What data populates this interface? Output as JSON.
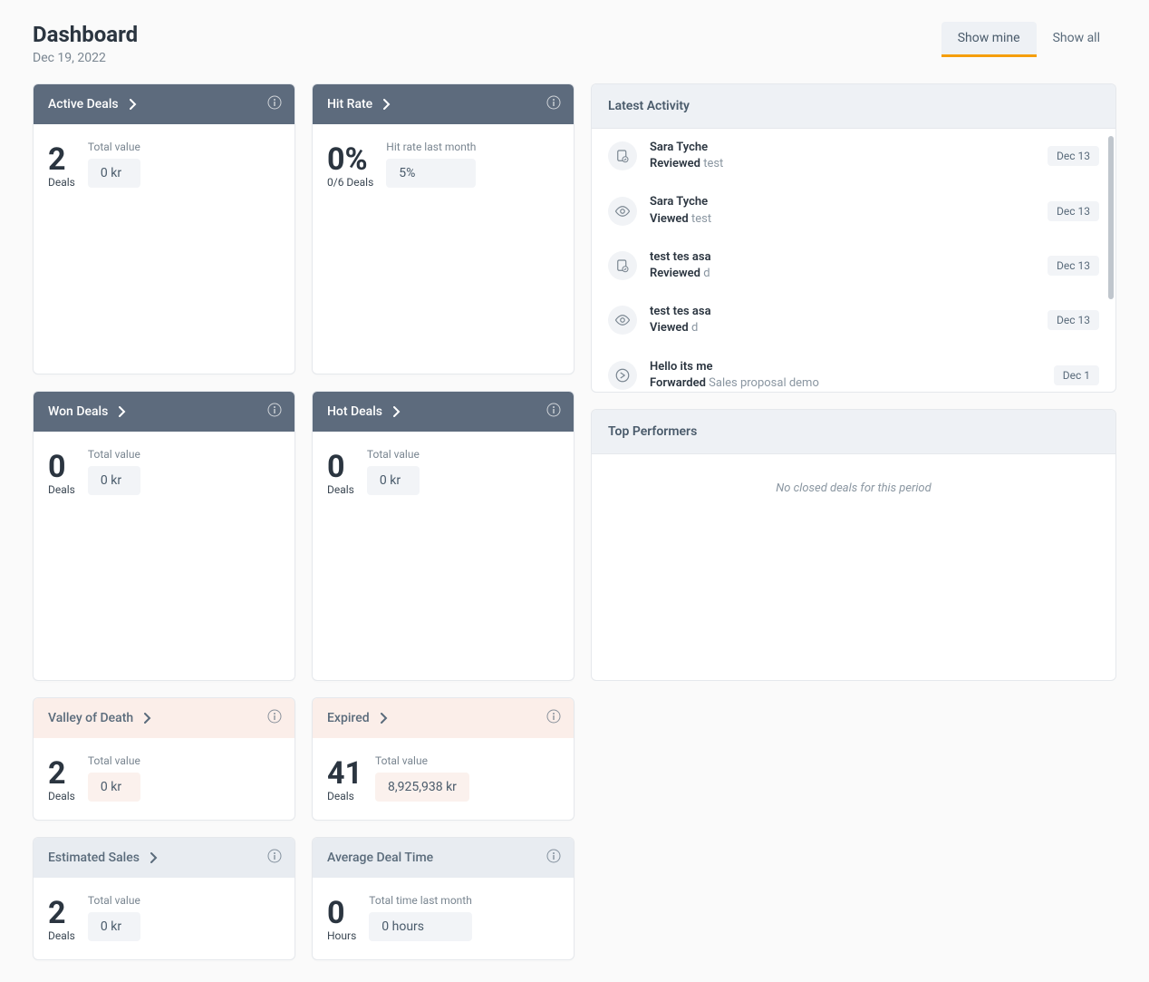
{
  "header": {
    "title": "Dashboard",
    "date": "Dec 19, 2022"
  },
  "tabs": {
    "show_mine": "Show mine",
    "show_all": "Show all"
  },
  "cards": {
    "active_deals": {
      "title": "Active Deals",
      "count": "2",
      "unit": "Deals",
      "sub_label": "Total value",
      "sub_value": "0 kr"
    },
    "hit_rate": {
      "title": "Hit Rate",
      "count": "0%",
      "unit": "0/6 Deals",
      "sub_label": "Hit rate last month",
      "sub_value": "5%"
    },
    "won_deals": {
      "title": "Won Deals",
      "count": "0",
      "unit": "Deals",
      "sub_label": "Total value",
      "sub_value": "0 kr"
    },
    "hot_deals": {
      "title": "Hot Deals",
      "count": "0",
      "unit": "Deals",
      "sub_label": "Total value",
      "sub_value": "0 kr"
    },
    "valley_of_death": {
      "title": "Valley of Death",
      "count": "2",
      "unit": "Deals",
      "sub_label": "Total value",
      "sub_value": "0 kr"
    },
    "expired": {
      "title": "Expired",
      "count": "41",
      "unit": "Deals",
      "sub_label": "Total value",
      "sub_value": "8,925,938 kr"
    },
    "estimated_sales": {
      "title": "Estimated Sales",
      "count": "2",
      "unit": "Deals",
      "sub_label": "Total value",
      "sub_value": "0 kr"
    },
    "avg_deal_time": {
      "title": "Average Deal Time",
      "count": "0",
      "unit": "Hours",
      "sub_label": "Total time last month",
      "sub_value": "0 hours"
    }
  },
  "latest_activity": {
    "title": "Latest Activity",
    "items": [
      {
        "person": "Sara Tyche",
        "action": "Reviewed",
        "target": "test",
        "date": "Dec 13",
        "icon": "reviewed"
      },
      {
        "person": "Sara Tyche",
        "action": "Viewed",
        "target": "test",
        "date": "Dec 13",
        "icon": "viewed"
      },
      {
        "person": "test tes asa",
        "action": "Reviewed",
        "target": "d",
        "date": "Dec 13",
        "icon": "reviewed"
      },
      {
        "person": "test tes asa",
        "action": "Viewed",
        "target": "d",
        "date": "Dec 13",
        "icon": "viewed"
      },
      {
        "person": "Hello its me",
        "action": "Forwarded",
        "target": "Sales proposal demo",
        "date": "Dec 1",
        "icon": "forwarded"
      }
    ],
    "partial": "test tes asa"
  },
  "top_performers": {
    "title": "Top Performers",
    "empty": "No closed deals for this period"
  }
}
